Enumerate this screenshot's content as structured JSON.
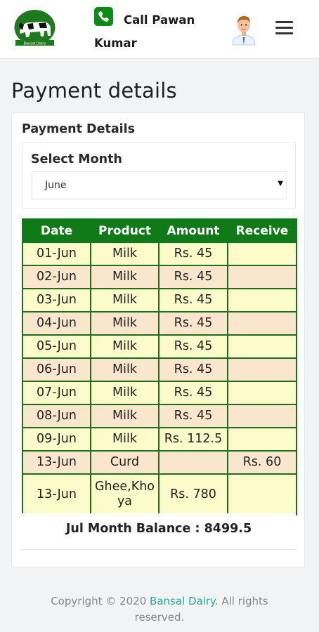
{
  "header": {
    "logo_alt": "Bansal Dairy",
    "call_text": "Call Pawan Kumar",
    "icons": {
      "phone": "phone-icon",
      "avatar": "user-avatar",
      "menu": "hamburger-menu-icon"
    }
  },
  "page": {
    "title": "Payment details"
  },
  "card": {
    "title": "Payment Details",
    "month_label": "Select Month",
    "month_value": "June"
  },
  "table": {
    "headers": [
      "Date",
      "Product",
      "Amount",
      "Receive"
    ],
    "rows": [
      [
        "01-Jun",
        "Milk",
        "Rs. 45",
        ""
      ],
      [
        "02-Jun",
        "Milk",
        "Rs. 45",
        ""
      ],
      [
        "03-Jun",
        "Milk",
        "Rs. 45",
        ""
      ],
      [
        "04-Jun",
        "Milk",
        "Rs. 45",
        ""
      ],
      [
        "05-Jun",
        "Milk",
        "Rs. 45",
        ""
      ],
      [
        "06-Jun",
        "Milk",
        "Rs. 45",
        ""
      ],
      [
        "07-Jun",
        "Milk",
        "Rs. 45",
        ""
      ],
      [
        "08-Jun",
        "Milk",
        "Rs. 45",
        ""
      ],
      [
        "09-Jun",
        "Milk",
        "Rs. 112.5",
        ""
      ],
      [
        "13-Jun",
        "Curd",
        "",
        "Rs. 60"
      ],
      [
        "13-Jun",
        "Ghee,Khoya",
        "Rs. 780",
        ""
      ]
    ]
  },
  "balance": {
    "text": "Jul Month Balance : 8499.5"
  },
  "footer": {
    "prefix": "Copyright © 2020 ",
    "brand": "Bansal Dairy",
    "suffix": ". All rights reserved."
  },
  "colors": {
    "brand_green": "#0f7a17",
    "row_odd": "#fdfbc9",
    "row_even": "#f9e6cc",
    "link": "#27ab8e"
  }
}
